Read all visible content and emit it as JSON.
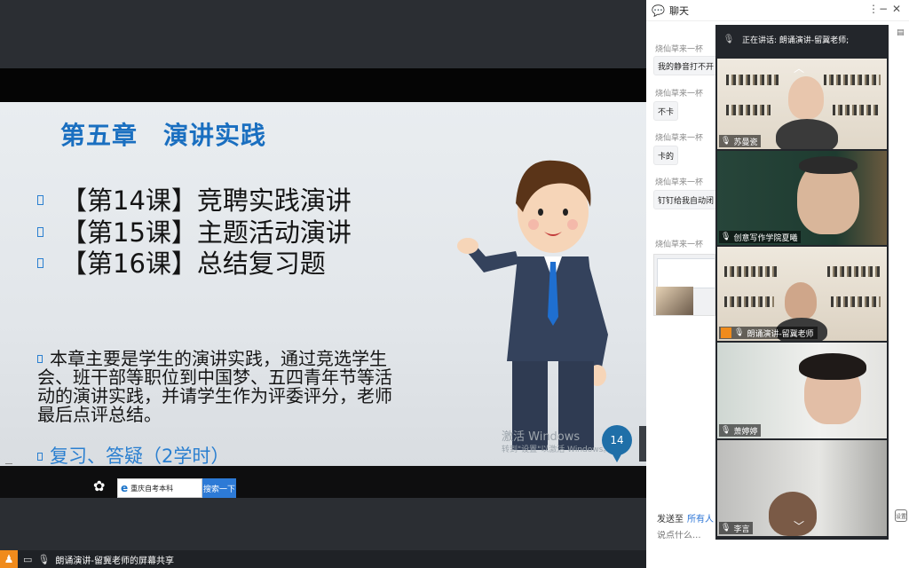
{
  "slide": {
    "title": "第五章　演讲实践",
    "lessons": [
      "【第14课】竞聘实践演讲",
      "【第15课】主题活动演讲",
      "【第16课】总结复习题"
    ],
    "summary": "本章主要是学生的演讲实践，通过竞选学生会、班干部等职位到中国梦、五四青年节等活动的演讲实践，并请学生作为评委评分，老师最后点评总结。",
    "review": "复习、答疑（2学时）",
    "watermark_line1": "激活 Windows",
    "watermark_line2": "转到\"设置\"以激活 Windows。",
    "page_number": "14"
  },
  "taskbar": {
    "search_text": "重庆自考本科",
    "search_button": "搜索一下"
  },
  "share_bar": {
    "label": "朗诵演讲-留冀老师的屏幕共享"
  },
  "chat": {
    "title": "聊天",
    "messages": [
      {
        "sender": "烧仙草来一杯",
        "text": "我的静音打不开"
      },
      {
        "sender": "烧仙草来一杯",
        "text": "不卡"
      },
      {
        "sender": "烧仙草来一杯",
        "text": "卡的"
      },
      {
        "sender": "烧仙草来一杯",
        "text": "钉钉给我自动闭"
      },
      {
        "sender": "烧仙草来一杯",
        "text": ""
      }
    ],
    "send_to_label": "发送至",
    "send_to_target": "所有人",
    "input_placeholder": "说点什么...",
    "side_icon_label": "设置"
  },
  "videos": {
    "speaking_label": "正在讲话: 朗诵演讲-留冀老师;",
    "tiles": [
      {
        "name": "苏曼瓷"
      },
      {
        "name": "创意写作学院夏曦"
      },
      {
        "name": "朗诵演讲-留冀老师"
      },
      {
        "name": "萧婷婷"
      },
      {
        "name": "李言"
      }
    ]
  }
}
